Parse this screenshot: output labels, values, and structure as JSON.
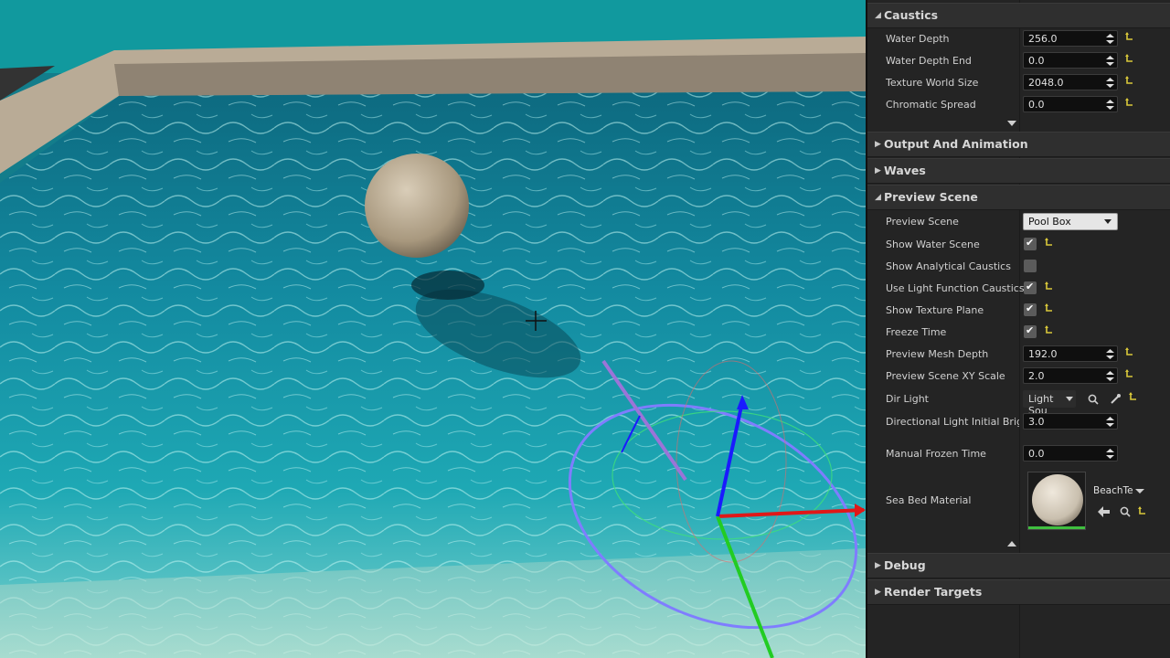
{
  "viewport": {
    "gizmo": {
      "axes": [
        "x-axis-red",
        "y-axis-green",
        "z-axis-blue"
      ]
    }
  },
  "details": {
    "caustics": {
      "title": "Caustics",
      "rows": [
        {
          "label": "Water Depth",
          "value": "256.0"
        },
        {
          "label": "Water Depth End",
          "value": "0.0"
        },
        {
          "label": "Texture World Size",
          "value": "2048.0"
        },
        {
          "label": "Chromatic Spread",
          "value": "0.0"
        }
      ]
    },
    "output_and_animation": {
      "title": "Output And Animation"
    },
    "waves": {
      "title": "Waves"
    },
    "preview_scene": {
      "title": "Preview Scene",
      "preview_scene": {
        "label": "Preview Scene",
        "value": "Pool Box"
      },
      "show_water_scene": {
        "label": "Show Water Scene",
        "checked": true
      },
      "show_analytical_caustics": {
        "label": "Show Analytical Caustics",
        "checked": false
      },
      "use_light_function_caustics": {
        "label": "Use Light Function Caustics",
        "checked": true
      },
      "show_texture_plane": {
        "label": "Show Texture Plane",
        "checked": true
      },
      "freeze_time": {
        "label": "Freeze Time",
        "checked": true
      },
      "preview_mesh_depth": {
        "label": "Preview Mesh Depth",
        "value": "192.0"
      },
      "preview_scene_xy_scale": {
        "label": "Preview Scene XY Scale",
        "value": "2.0"
      },
      "dir_light": {
        "label": "Dir Light",
        "value": "Light Sou"
      },
      "directional_light_initial_bright": {
        "label": "Directional Light Initial Bright",
        "value": "3.0"
      },
      "manual_frozen_time": {
        "label": "Manual Frozen Time",
        "value": "0.0"
      },
      "sea_bed_material": {
        "label": "Sea Bed Material",
        "asset": "BeachTe"
      }
    },
    "debug": {
      "title": "Debug"
    },
    "render_targets": {
      "title": "Render Targets"
    }
  },
  "colors": {
    "panel_bg": "#242424",
    "category_bg": "#2f2f2f",
    "field_bg": "#0f0f0f",
    "reset_arrow": "#d9c83a",
    "water": "#1aa0b0"
  }
}
